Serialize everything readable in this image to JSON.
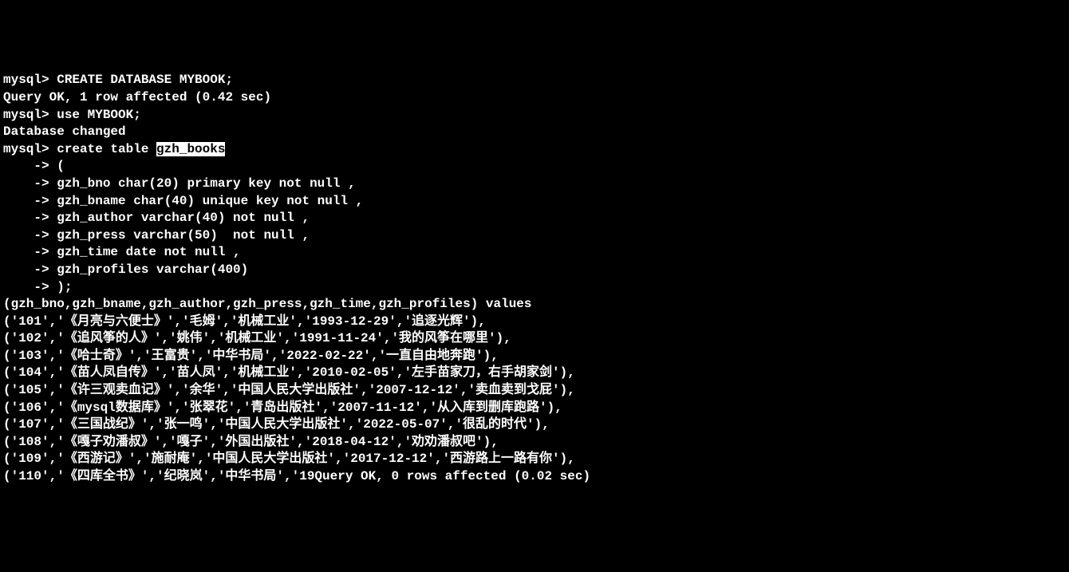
{
  "lines": [
    {
      "prompt": "mysql> ",
      "text": "CREATE DATABASE MYBOOK;"
    },
    {
      "prompt": "",
      "text": "Query OK, 1 row affected (0.42 sec)"
    },
    {
      "prompt": "",
      "text": ""
    },
    {
      "prompt": "mysql> ",
      "text": "use MYBOOK;"
    },
    {
      "prompt": "",
      "text": "Database changed"
    },
    {
      "prompt": "mysql> ",
      "text_before": "create table ",
      "highlight": "gzh_books",
      "text_after": ""
    },
    {
      "prompt": "    -> ",
      "text": "("
    },
    {
      "prompt": "    -> ",
      "text": "gzh_bno char(20) primary key not null ,"
    },
    {
      "prompt": "    -> ",
      "text": "gzh_bname char(40) unique key not null ,"
    },
    {
      "prompt": "    -> ",
      "text": "gzh_author varchar(40) not null ,"
    },
    {
      "prompt": "    -> ",
      "text": "gzh_press varchar(50)  not null ,"
    },
    {
      "prompt": "    -> ",
      "text": "gzh_time date not null ,"
    },
    {
      "prompt": "    -> ",
      "text": "gzh_profiles varchar(400)"
    },
    {
      "prompt": "    -> ",
      "text": ");"
    },
    {
      "prompt": "",
      "text": "(gzh_bno,gzh_bname,gzh_author,gzh_press,gzh_time,gzh_profiles) values"
    },
    {
      "prompt": "",
      "text": "('101','《月亮与六便士》','毛姆','机械工业','1993-12-29','追逐光辉'),"
    },
    {
      "prompt": "",
      "text": "('102','《追风筝的人》','姚伟','机械工业','1991-11-24','我的风筝在哪里'),"
    },
    {
      "prompt": "",
      "text": "('103','《哈士奇》','王富贵','中华书局','2022-02-22','一直自由地奔跑'),"
    },
    {
      "prompt": "",
      "text": "('104','《苗人凤自传》','苗人凤','机械工业','2010-02-05','左手苗家刀，右手胡家剑'),"
    },
    {
      "prompt": "",
      "text": "('105','《许三观卖血记》','余华','中国人民大学出版社','2007-12-12','卖血卖到戈屁'),"
    },
    {
      "prompt": "",
      "text": "('106','《mysql数据库》','张翠花','青岛出版社','2007-11-12','从入库到删库跑路'),"
    },
    {
      "prompt": "",
      "text": "('107','《三国战纪》','张一鸣','中国人民大学出版社','2022-05-07','很乱的时代'),"
    },
    {
      "prompt": "",
      "text": "('108','《嘎子劝潘叔》','嘎子','外国出版社','2018-04-12','劝劝潘叔吧'),"
    },
    {
      "prompt": "",
      "text": "('109','《西游记》','施耐庵','中国人民大学出版社','2017-12-12','西游路上一路有你'),"
    },
    {
      "prompt": "",
      "text": "('110','《四库全书》','纪晓岚','中华书局','19Query OK, 0 rows affected (0.02 sec)"
    }
  ]
}
